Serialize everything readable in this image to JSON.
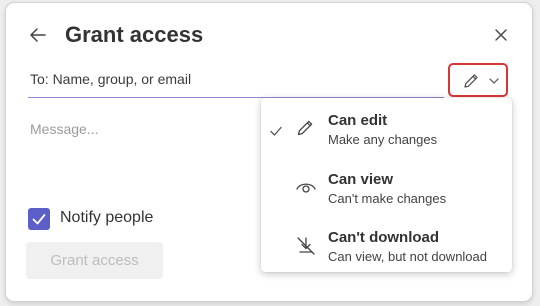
{
  "dialog": {
    "title": "Grant access",
    "to_placeholder": "To: Name, group, or email",
    "message_placeholder": "Message...",
    "notify_label": "Notify people",
    "notify_checked": true,
    "grant_button_label": "Grant access"
  },
  "permission_button": {
    "icon": "pencil-icon",
    "dropdown_icon": "chevron-down-icon"
  },
  "permission_menu": {
    "items": [
      {
        "title": "Can edit",
        "subtitle": "Make any changes",
        "icon": "pencil-icon",
        "selected": true
      },
      {
        "title": "Can view",
        "subtitle": "Can't make changes",
        "icon": "eye-icon",
        "selected": false
      },
      {
        "title": "Can't download",
        "subtitle": "Can view, but not download",
        "icon": "no-download-icon",
        "selected": false
      }
    ]
  },
  "colors": {
    "accent": "#5b5fc7",
    "highlight_border": "#d93636"
  }
}
